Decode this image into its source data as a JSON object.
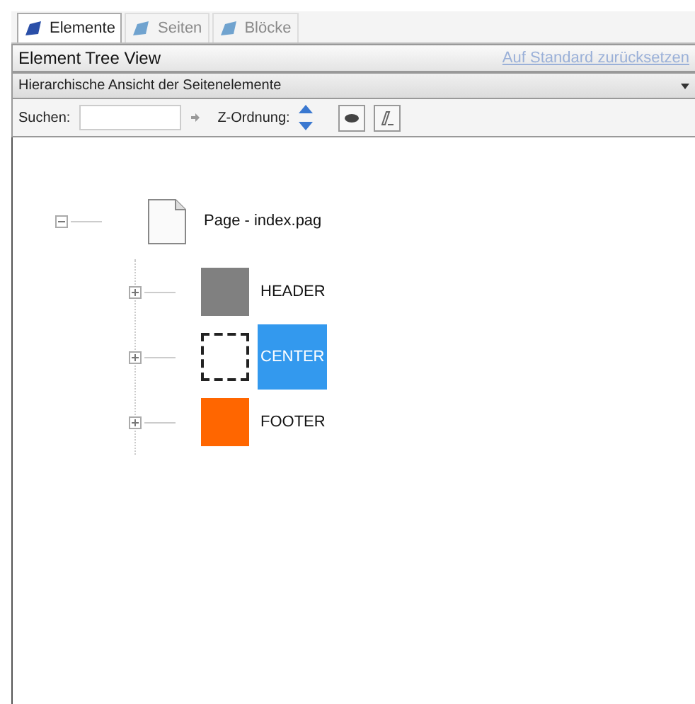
{
  "tabs": [
    {
      "label": "Elemente",
      "selected": true,
      "disabled": false
    },
    {
      "label": "Seiten",
      "selected": false,
      "disabled": true
    },
    {
      "label": "Blöcke",
      "selected": false,
      "disabled": true
    }
  ],
  "panel": {
    "title": "Element Tree View",
    "reset_link": "Auf Standard zurücksetzen"
  },
  "view_dropdown": {
    "value": "Hierarchische Ansicht der Seitenelemente"
  },
  "toolbar": {
    "search_label": "Suchen:",
    "z_order_label": "Z-Ordnung:"
  },
  "tree": {
    "label": "Page  -  index.pag",
    "expanded": true,
    "children": [
      {
        "label": "HEADER",
        "color": "#808080",
        "expanded": false,
        "selected": false
      },
      {
        "label": "CENTER",
        "color": "#ffffff",
        "expanded": false,
        "selected": true
      },
      {
        "label": "FOOTER",
        "color": "#ff6600",
        "expanded": false,
        "selected": false
      }
    ]
  }
}
